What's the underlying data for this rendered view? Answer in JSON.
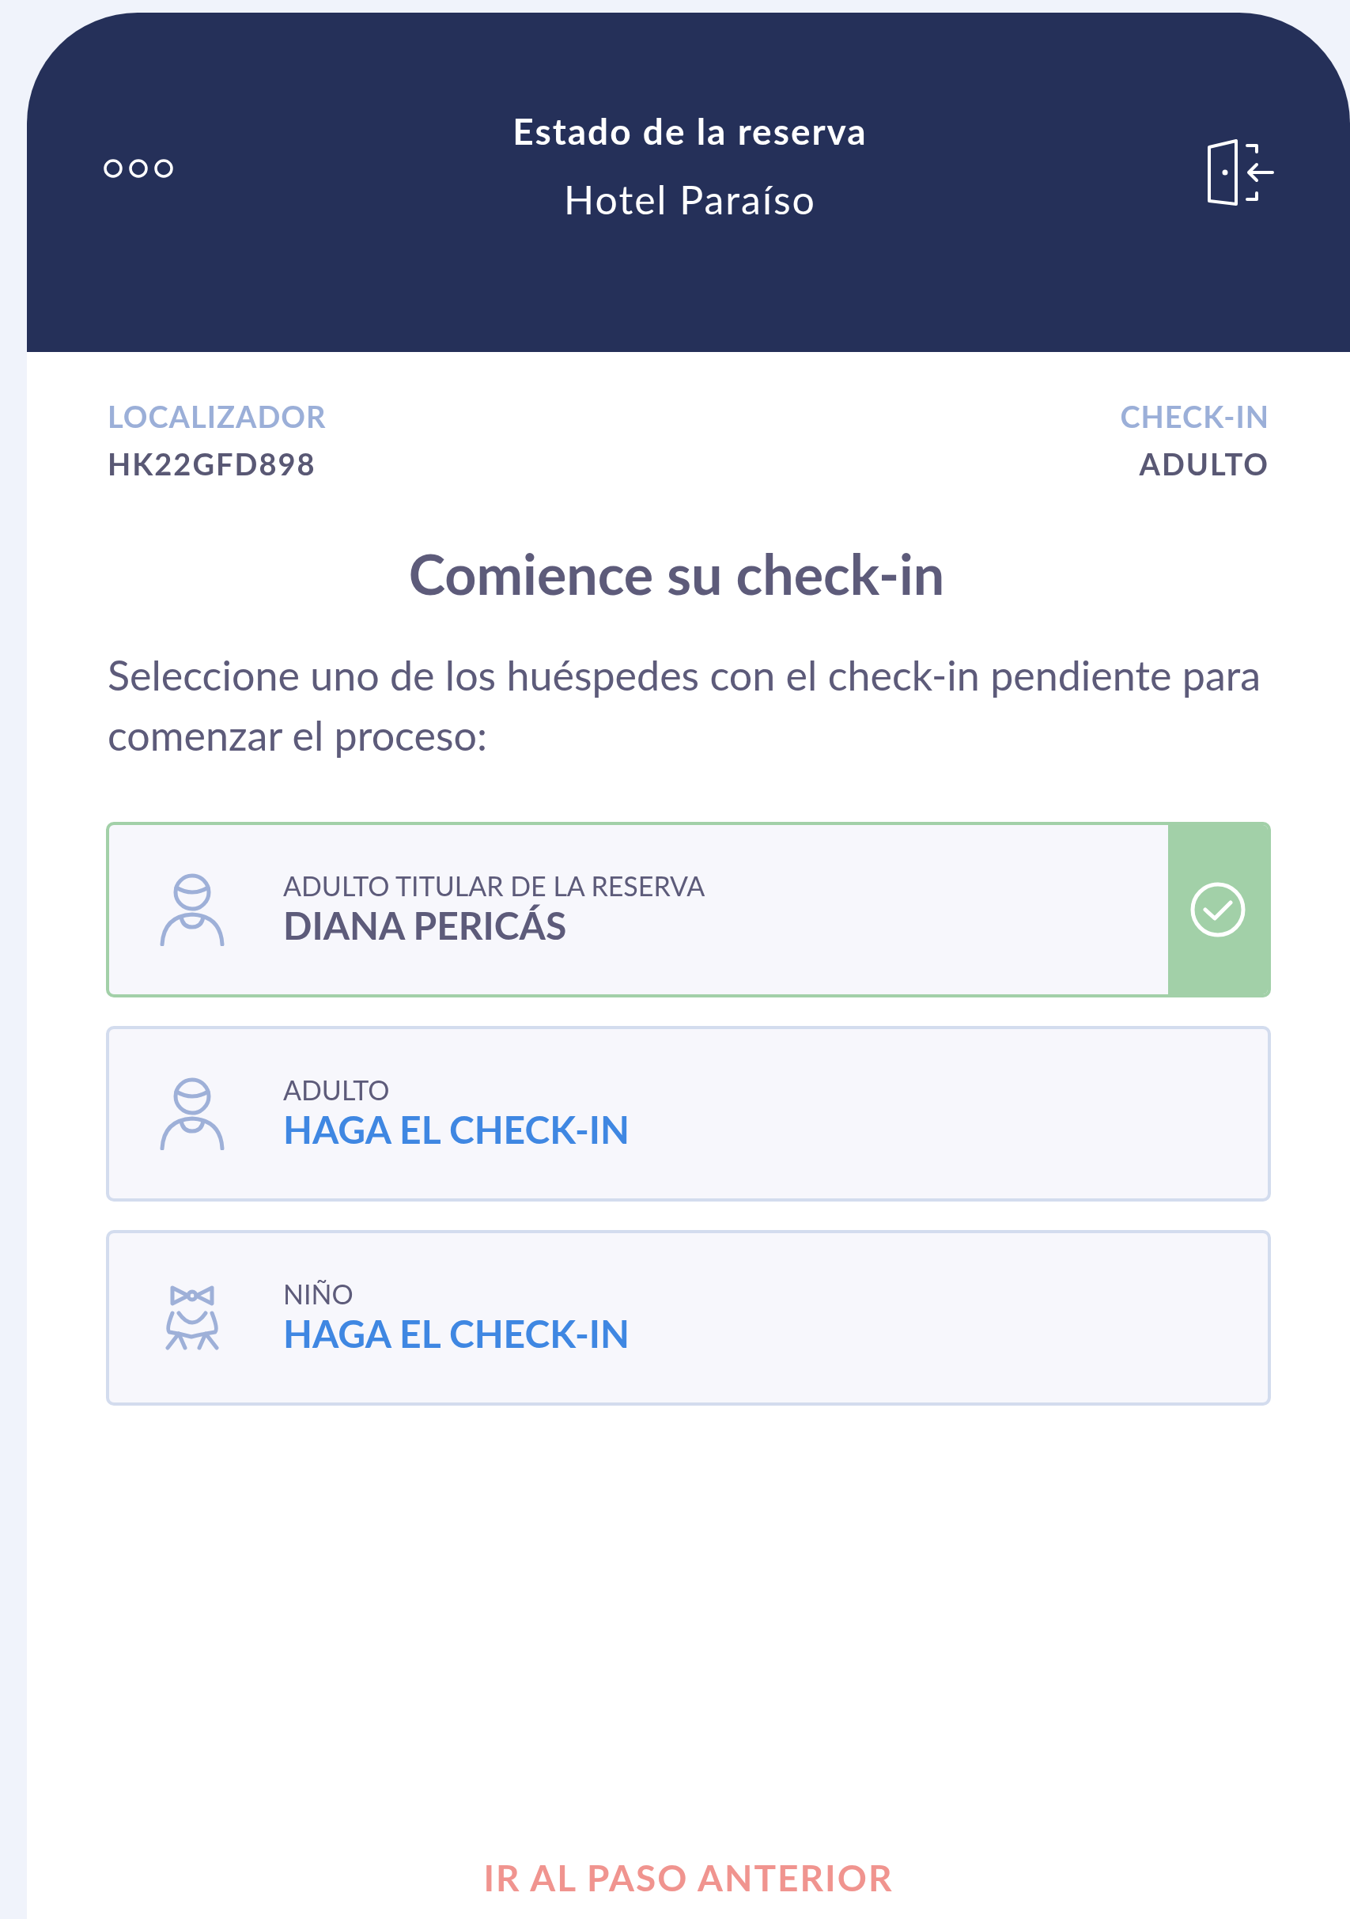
{
  "header": {
    "title": "Estado de la reserva",
    "subtitle": "Hotel Paraíso"
  },
  "booking": {
    "locator_label": "LOCALIZADOR",
    "locator": "HK22GFD898",
    "checkin_label": "CHECK-IN",
    "checkin_value": "ADULTO"
  },
  "heading": "Comience su check-in",
  "instructions": "Seleccione uno de los huéspedes con el check-in pendiente para comenzar el proceso:",
  "guests": [
    {
      "kind": "adult",
      "label": "ADULTO TITULAR DE LA RESERVA",
      "value": "DIANA PERICÁS",
      "checked": true
    },
    {
      "kind": "adult",
      "label": "ADULTO",
      "value": "HAGA EL CHECK-IN",
      "checked": false
    },
    {
      "kind": "child",
      "label": "NIÑO",
      "value": "HAGA EL CHECK-IN",
      "checked": false
    }
  ],
  "back_link": "IR AL PASO ANTERIOR"
}
